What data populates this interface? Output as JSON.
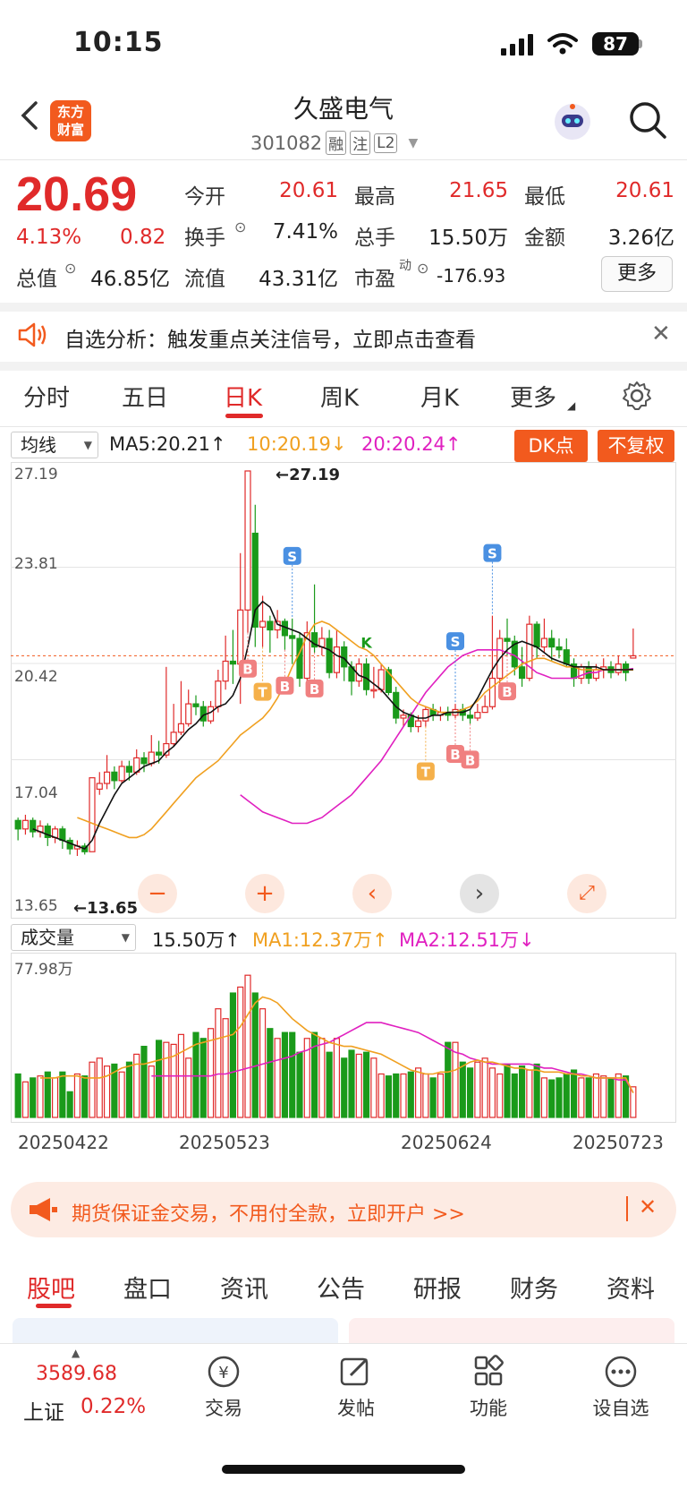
{
  "status_bar": {
    "time": "10:15",
    "battery": "87"
  },
  "header": {
    "logo_line1": "东方",
    "logo_line2": "财富",
    "title": "久盛电气",
    "code": "301082",
    "tags": [
      "融",
      "注",
      "L2"
    ]
  },
  "quote": {
    "price": "20.69",
    "change_pct": "4.13%",
    "change": "0.82",
    "fields": [
      {
        "label": "今开",
        "value": "20.61"
      },
      {
        "label": "最高",
        "value": "21.65"
      },
      {
        "label": "最低",
        "value": "20.61"
      },
      {
        "label": "换手",
        "value": "7.41%"
      },
      {
        "label": "总手",
        "value": "15.50万"
      },
      {
        "label": "金额",
        "value": "3.26亿"
      },
      {
        "label": "总值",
        "value": "46.85亿"
      },
      {
        "label": "流值",
        "value": "43.31亿"
      },
      {
        "label": "市盈",
        "value": "-176.93"
      }
    ],
    "pe_sup": "动",
    "more": "更多"
  },
  "notice": {
    "text": "自选分析：触发重点关注信号，立即点击查看"
  },
  "kline_tabs": [
    "分时",
    "五日",
    "日K",
    "周K",
    "月K",
    "更多"
  ],
  "kline_active": "日K",
  "indicator": {
    "select": "均线",
    "ma5": "MA5:20.21↑",
    "ma10": "10:20.19↓",
    "ma20": "20:20.24↑",
    "dk": "DK点",
    "fq": "不复权"
  },
  "price_axis": [
    "27.19",
    "23.81",
    "20.42",
    "17.04",
    "13.65"
  ],
  "annotations": {
    "high": "←27.19",
    "low": "←13.65"
  },
  "volume": {
    "select": "成交量",
    "value": "15.50万↑",
    "ma1": "MA1:12.37万↑",
    "ma2": "MA2:12.51万↓",
    "max": "77.98万"
  },
  "dates": [
    "20250422",
    "20250523",
    "20250624",
    "20250723"
  ],
  "ad": {
    "text": "期货保证金交易，不用付全款，立即开户 >>"
  },
  "bottom_tabs": [
    "股吧",
    "盘口",
    "资讯",
    "公告",
    "研报",
    "财务",
    "资料"
  ],
  "bottom_nav": {
    "index_value": "3589.68",
    "index_name": "上证",
    "index_change": "0.22%",
    "items": [
      "交易",
      "发帖",
      "功能",
      "设自选"
    ]
  },
  "colors": {
    "up": "#e02a2a",
    "down": "#1a9a1a",
    "ma5": "#111111",
    "ma10": "#f0a020",
    "ma20": "#e020c0",
    "accent": "#f25a1e"
  },
  "chart_data": {
    "type": "candlestick",
    "ylim": [
      13.65,
      27.19
    ],
    "candles": [
      [
        14.9,
        14.6,
        15.0,
        14.2
      ],
      [
        14.6,
        14.9,
        15.1,
        14.4
      ],
      [
        14.9,
        14.5,
        15.0,
        14.3
      ],
      [
        14.5,
        14.7,
        14.9,
        14.3
      ],
      [
        14.7,
        14.3,
        14.8,
        14.0
      ],
      [
        14.3,
        14.6,
        14.7,
        14.1
      ],
      [
        14.6,
        14.2,
        14.7,
        13.9
      ],
      [
        14.2,
        13.9,
        14.3,
        13.7
      ],
      [
        13.9,
        14.0,
        14.2,
        13.65
      ],
      [
        14.0,
        13.8,
        14.1,
        13.7
      ],
      [
        13.8,
        16.4,
        16.4,
        13.8
      ],
      [
        16.0,
        16.2,
        16.6,
        15.8
      ],
      [
        16.2,
        16.6,
        17.2,
        16.0
      ],
      [
        16.6,
        16.3,
        16.8,
        16.0
      ],
      [
        16.3,
        16.8,
        17.0,
        16.2
      ],
      [
        16.8,
        16.6,
        17.0,
        16.3
      ],
      [
        16.6,
        17.1,
        17.4,
        16.5
      ],
      [
        17.1,
        16.9,
        17.3,
        16.6
      ],
      [
        16.9,
        17.3,
        17.9,
        16.8
      ],
      [
        17.3,
        17.2,
        17.7,
        16.9
      ],
      [
        17.2,
        17.6,
        20.3,
        17.1
      ],
      [
        17.6,
        18.0,
        19.0,
        17.5
      ],
      [
        18.0,
        18.3,
        19.8,
        17.9
      ],
      [
        18.3,
        19.0,
        19.5,
        18.2
      ],
      [
        19.0,
        18.9,
        19.3,
        18.6
      ],
      [
        18.9,
        18.4,
        19.1,
        18.2
      ],
      [
        18.4,
        18.9,
        19.1,
        18.3
      ],
      [
        18.9,
        19.8,
        20.2,
        18.7
      ],
      [
        19.8,
        20.5,
        21.4,
        19.5
      ],
      [
        20.5,
        20.4,
        21.6,
        19.7
      ],
      [
        20.4,
        22.3,
        24.3,
        19.0
      ],
      [
        22.3,
        27.19,
        27.19,
        21.5
      ],
      [
        25.0,
        21.7,
        26.0,
        21.0
      ],
      [
        21.7,
        21.9,
        22.8,
        21.0
      ],
      [
        21.9,
        21.6,
        22.1,
        20.8
      ],
      [
        21.6,
        21.9,
        22.3,
        21.3
      ],
      [
        21.9,
        21.4,
        22.0,
        20.9
      ],
      [
        21.4,
        21.3,
        22.0,
        20.4
      ],
      [
        21.3,
        19.9,
        21.5,
        19.6
      ],
      [
        19.9,
        21.5,
        21.9,
        19.8
      ],
      [
        21.5,
        21.0,
        23.2,
        20.8
      ],
      [
        21.0,
        21.3,
        21.7,
        20.7
      ],
      [
        21.3,
        20.1,
        21.6,
        19.9
      ],
      [
        20.1,
        21.0,
        21.6,
        19.9
      ],
      [
        21.0,
        20.3,
        21.2,
        19.8
      ],
      [
        20.3,
        19.8,
        20.5,
        19.3
      ],
      [
        19.8,
        20.4,
        20.6,
        19.6
      ],
      [
        20.4,
        19.5,
        20.6,
        19.3
      ],
      [
        19.5,
        19.5,
        20.3,
        19.2
      ],
      [
        19.5,
        20.2,
        20.4,
        19.4
      ],
      [
        20.2,
        19.4,
        20.3,
        19.3
      ],
      [
        19.4,
        18.5,
        19.6,
        18.3
      ],
      [
        18.5,
        18.6,
        18.8,
        18.2
      ],
      [
        18.6,
        18.2,
        18.7,
        18.0
      ],
      [
        18.2,
        18.4,
        18.6,
        18.0
      ],
      [
        18.4,
        18.8,
        18.9,
        18.2
      ],
      [
        18.8,
        18.6,
        19.0,
        18.4
      ],
      [
        18.6,
        18.7,
        18.9,
        18.4
      ],
      [
        18.7,
        18.6,
        18.9,
        18.4
      ],
      [
        18.6,
        18.8,
        19.0,
        18.5
      ],
      [
        18.8,
        18.6,
        19.0,
        18.4
      ],
      [
        18.6,
        18.5,
        18.8,
        18.3
      ],
      [
        18.5,
        18.7,
        19.0,
        18.4
      ],
      [
        18.7,
        18.9,
        19.3,
        18.7
      ],
      [
        18.9,
        19.9,
        22.1,
        18.8
      ],
      [
        19.9,
        21.3,
        21.6,
        19.7
      ],
      [
        21.3,
        21.2,
        22.0,
        20.7
      ],
      [
        21.2,
        20.3,
        21.4,
        20.0
      ],
      [
        20.3,
        19.9,
        21.0,
        19.6
      ],
      [
        19.9,
        21.8,
        22.1,
        19.8
      ],
      [
        21.8,
        21.0,
        21.9,
        20.6
      ],
      [
        21.0,
        21.3,
        22.0,
        20.8
      ],
      [
        21.3,
        21.0,
        21.6,
        20.5
      ],
      [
        21.0,
        20.9,
        21.3,
        20.6
      ],
      [
        20.9,
        20.4,
        21.3,
        20.3
      ],
      [
        20.4,
        19.9,
        20.6,
        19.6
      ],
      [
        19.9,
        20.3,
        20.4,
        19.7
      ],
      [
        20.3,
        19.9,
        20.5,
        19.7
      ],
      [
        19.9,
        20.2,
        20.4,
        19.8
      ],
      [
        20.2,
        20.3,
        20.6,
        19.9
      ],
      [
        20.3,
        20.1,
        20.5,
        19.9
      ],
      [
        20.1,
        20.4,
        20.7,
        20.0
      ],
      [
        20.4,
        20.1,
        20.5,
        19.8
      ],
      [
        20.61,
        20.69,
        21.65,
        20.61
      ]
    ],
    "ma5": [
      14.6,
      14.5,
      14.4,
      14.3,
      14.2,
      14.1,
      14.0,
      13.9,
      14.2,
      14.8,
      15.3,
      15.8,
      16.2,
      16.4,
      16.6,
      16.8,
      16.9,
      17.0,
      17.3,
      17.5,
      17.8,
      18.1,
      18.3,
      18.6,
      18.7,
      18.9,
      19.0,
      19.3,
      19.9,
      21.0,
      22.3,
      22.6,
      22.4,
      21.8,
      21.7,
      21.6,
      21.5,
      21.3,
      21.1,
      21.0,
      20.9,
      20.7,
      20.6,
      20.3,
      20.0,
      19.9,
      19.7,
      19.5,
      19.2,
      18.9,
      18.7,
      18.6,
      18.5,
      18.5,
      18.6,
      18.6,
      18.7,
      18.7,
      18.7,
      18.8,
      19.2,
      19.7,
      20.2,
      20.6,
      20.9,
      21.1,
      21.2,
      21.1,
      21.0,
      20.8,
      20.6,
      20.5,
      20.4,
      20.3,
      20.3,
      20.3,
      20.3,
      20.2,
      20.2,
      20.2,
      20.2,
      20.21
    ],
    "ma10": [
      15.0,
      14.9,
      14.8,
      14.7,
      14.6,
      14.5,
      14.4,
      14.3,
      14.3,
      14.4,
      14.6,
      14.9,
      15.2,
      15.5,
      15.8,
      16.1,
      16.4,
      16.6,
      16.8,
      17.0,
      17.3,
      17.6,
      17.9,
      18.1,
      18.3,
      18.5,
      18.8,
      19.2,
      19.7,
      20.3,
      20.8,
      21.4,
      21.8,
      21.9,
      21.8,
      21.6,
      21.4,
      21.2,
      21.0,
      20.9,
      20.7,
      20.4,
      20.1,
      19.8,
      19.5,
      19.2,
      19.0,
      18.9,
      18.8,
      18.7,
      18.7,
      18.7,
      18.8,
      18.9,
      19.1,
      19.4,
      19.6,
      19.8,
      20.0,
      20.2,
      20.4,
      20.5,
      20.6,
      20.6,
      20.5,
      20.4,
      20.3,
      20.3,
      20.2,
      20.2,
      20.2,
      20.2,
      20.2,
      20.2,
      20.2,
      20.19
    ],
    "ma20": [
      15.8,
      15.6,
      15.4,
      15.2,
      15.1,
      15.0,
      14.9,
      14.8,
      14.8,
      14.8,
      14.9,
      15.0,
      15.2,
      15.4,
      15.6,
      15.8,
      16.1,
      16.4,
      16.7,
      17.0,
      17.4,
      17.8,
      18.2,
      18.6,
      19.0,
      19.4,
      19.7,
      20.0,
      20.3,
      20.5,
      20.7,
      20.8,
      20.9,
      20.9,
      20.9,
      20.9,
      20.8,
      20.7,
      20.5,
      20.3,
      20.1,
      20.0,
      19.9,
      19.9,
      19.9,
      19.9,
      20.0,
      20.1,
      20.1,
      20.2,
      20.2,
      20.2,
      20.2,
      20.24
    ],
    "volumes": [
      22,
      18,
      20,
      21,
      23,
      20,
      23,
      13,
      22,
      21,
      28,
      30,
      26,
      27,
      23,
      28,
      32,
      36,
      26,
      39,
      38,
      37,
      42,
      30,
      43,
      40,
      45,
      55,
      50,
      63,
      66,
      72,
      63,
      55,
      45,
      40,
      43,
      43,
      33,
      40,
      43,
      40,
      33,
      40,
      30,
      34,
      32,
      33,
      30,
      22,
      21,
      22,
      22,
      23,
      25,
      22,
      20,
      22,
      38,
      38,
      28,
      25,
      28,
      30,
      25,
      22,
      27,
      22,
      26,
      24,
      27,
      20,
      19,
      20,
      22,
      24,
      20,
      20,
      22,
      21,
      20,
      22,
      21,
      15.5
    ],
    "vol_ma1": [
      20,
      20,
      20,
      21,
      21,
      21,
      20,
      20,
      20,
      21,
      23,
      25,
      26,
      27,
      27,
      28,
      29,
      30,
      31,
      33,
      35,
      37,
      38,
      39,
      40,
      41,
      42,
      46,
      52,
      58,
      61,
      60,
      58,
      54,
      50,
      47,
      44,
      42,
      40,
      38,
      37,
      36,
      36,
      35,
      34,
      33,
      32,
      30,
      28,
      26,
      24,
      23,
      22,
      22,
      23,
      23,
      24,
      26,
      28,
      29,
      28,
      28,
      27,
      26,
      25,
      25,
      24,
      24,
      23,
      23,
      23,
      22,
      22,
      21,
      21,
      20,
      20,
      20,
      20,
      20,
      12.37
    ],
    "vol_ma2": [
      21,
      21,
      21,
      21,
      21,
      21,
      21,
      21,
      21,
      22,
      22,
      23,
      24,
      25,
      26,
      27,
      28,
      29,
      30,
      31,
      33,
      34,
      36,
      37,
      38,
      40,
      42,
      44,
      46,
      48,
      48,
      48,
      47,
      46,
      45,
      44,
      43,
      41,
      39,
      37,
      35,
      33,
      32,
      30,
      29,
      28,
      27,
      27,
      27,
      27,
      27,
      27,
      26,
      25,
      25,
      24,
      23,
      22,
      22,
      21,
      20,
      20,
      20,
      19,
      19,
      12.51
    ],
    "signals": [
      {
        "type": "S",
        "i": 37
      },
      {
        "type": "S",
        "i": 59
      },
      {
        "type": "S",
        "i": 64
      },
      {
        "type": "B",
        "i": 31
      },
      {
        "type": "B",
        "i": 36
      },
      {
        "type": "B",
        "i": 40
      },
      {
        "type": "B",
        "i": 59
      },
      {
        "type": "B",
        "i": 61
      },
      {
        "type": "B",
        "i": 66
      },
      {
        "type": "T",
        "i": 33
      },
      {
        "type": "T",
        "i": 55
      },
      {
        "type": "K",
        "i": 47
      }
    ]
  }
}
